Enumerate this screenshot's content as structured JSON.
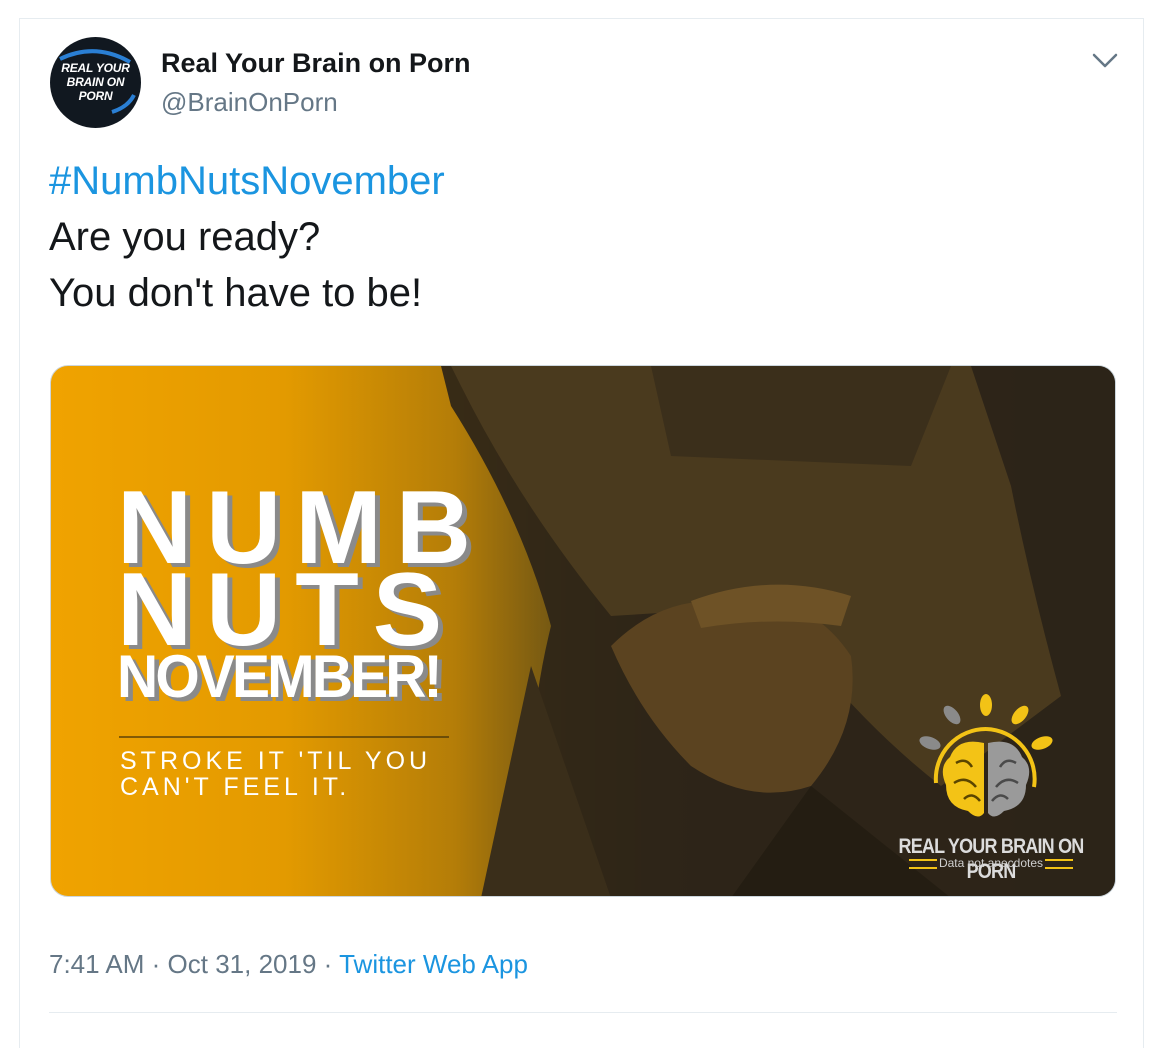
{
  "author": {
    "avatar_text": "REAL YOUR BRAIN ON PORN",
    "name": "Real Your Brain on Porn",
    "handle": "@BrainOnPorn"
  },
  "tweet": {
    "hashtag": "#NumbNutsNovember",
    "line1": "Are you ready?",
    "line2": "You don't have to be!"
  },
  "media": {
    "headline1": "NUMB",
    "headline2": "NUTS",
    "headline3": "NOVEMBER!",
    "tagline": "STROKE IT 'TIL YOU CAN'T FEEL IT.",
    "logo_name": "REAL YOUR BRAIN ON PORN",
    "logo_sub": "Data not anecdotes"
  },
  "meta": {
    "time": "7:41 AM",
    "separator": "·",
    "date": "Oct 31, 2019",
    "source": "Twitter Web App"
  },
  "icons": {
    "more": "chevron-down-icon"
  },
  "colors": {
    "link": "#1b95e0",
    "secondary_text": "#657786",
    "accent_orange": "#f0a300"
  }
}
